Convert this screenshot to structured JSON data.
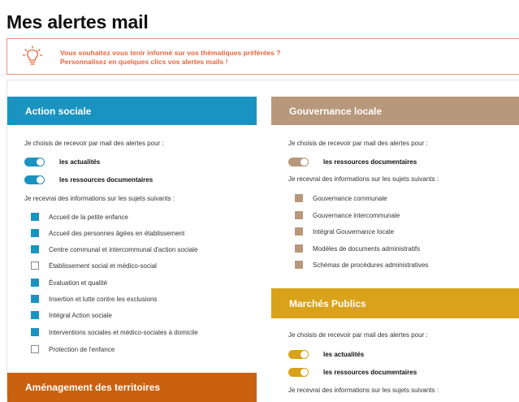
{
  "page": {
    "title": "Mes alertes mail"
  },
  "info": {
    "line1": "Vous souhaitez vous tenir informé sur vos thématiques préférées ?",
    "line2": "Personnalisez en quelques clics vos alertes mails !",
    "color": "#e8643a",
    "icon": "lightbulb-icon"
  },
  "action_sociale": {
    "title": "Action sociale",
    "color": "#1a93c1",
    "intro": "Je choisis de recevoir par mail des alertes pour :",
    "toggles": [
      {
        "label": "les actualités",
        "on": true
      },
      {
        "label": "les ressources documentaires",
        "on": true
      }
    ],
    "subjects_intro": "Je recevrai des informations sur les sujets suivants :",
    "subjects": [
      {
        "label": "Accueil de la petite enfance",
        "checked": true
      },
      {
        "label": "Accueil des personnes âgées en établissement",
        "checked": true
      },
      {
        "label": "Centre communal et intercommunal d'action sociale",
        "checked": true
      },
      {
        "label": "Établissement social et médico-social",
        "checked": false
      },
      {
        "label": "Évaluation et qualité",
        "checked": true
      },
      {
        "label": "Insertion et lutte contre les exclusions",
        "checked": true
      },
      {
        "label": "Intégral Action sociale",
        "checked": true
      },
      {
        "label": "Interventions sociales et médico-sociales à domicile",
        "checked": true
      },
      {
        "label": "Protection de l'enfance",
        "checked": false
      }
    ]
  },
  "amenagement": {
    "title": "Aménagement des territoires",
    "color": "#c9610f"
  },
  "gouvernance": {
    "title": "Gouvernance locale",
    "color": "#b7987a",
    "intro": "Je choisis de recevoir par mail des alertes pour :",
    "toggles": [
      {
        "label": "les ressources documentaires",
        "on": true
      }
    ],
    "subjects_intro": "Je recevrai des informations sur les sujets suivants :",
    "subjects": [
      {
        "label": "Gouvernance communale",
        "checked": true
      },
      {
        "label": "Gouvernance intercommunale",
        "checked": true
      },
      {
        "label": "Intégral Gouvernance locale",
        "checked": true
      },
      {
        "label": "Modèles de documents administratifs",
        "checked": true
      },
      {
        "label": "Schémas de procédures administratives",
        "checked": true
      }
    ]
  },
  "marches": {
    "title": "Marchés Publics",
    "color": "#d8a21a",
    "intro": "Je choisis de recevoir par mail des alertes pour :",
    "toggles": [
      {
        "label": "les actualités",
        "on": true
      },
      {
        "label": "les ressources documentaires",
        "on": true
      }
    ],
    "subjects_intro": "Je recevrai des informations sur les sujets suivants :"
  }
}
